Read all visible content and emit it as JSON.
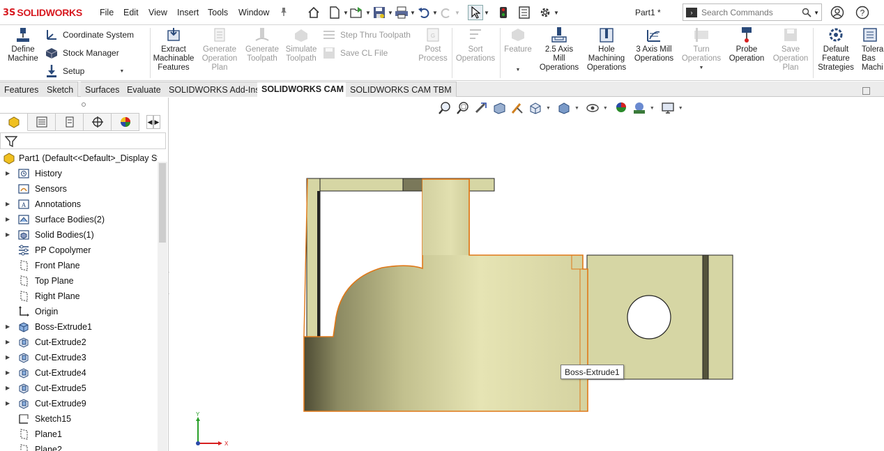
{
  "app": {
    "logo_ds": "3S",
    "logo_brand": "SOLIDWORKS",
    "menus": [
      "File",
      "Edit",
      "View",
      "Insert",
      "Tools",
      "Window"
    ],
    "document_title": "Part1 *",
    "search_placeholder": "Search Commands"
  },
  "command_manager": {
    "define_machine": "Define\nMachine",
    "coordinate_system": "Coordinate System",
    "stock_manager": "Stock Manager",
    "setup": "Setup",
    "extract_features": "Extract\nMachinable\nFeatures",
    "generate_operation_plan": "Generate\nOperation\nPlan",
    "generate_toolpath": "Generate\nToolpath",
    "simulate_toolpath": "Simulate\nToolpath",
    "step_thru_toolpath": "Step Thru Toolpath",
    "save_cl_file": "Save CL File",
    "post_process": "Post\nProcess",
    "sort_operations": "Sort\nOperations",
    "feature": "Feature",
    "axis25_mill": "2.5 Axis\nMill\nOperations",
    "hole_machining": "Hole\nMachining\nOperations",
    "axis3_mill": "3 Axis Mill\nOperations",
    "turn_operations": "Turn\nOperations",
    "probe_operation": "Probe\nOperation",
    "save_operation_plan": "Save\nOperation\nPlan",
    "default_feature_strategies": "Default\nFeature\nStrategies",
    "tolerance_based": "Tolera\nBas\nMachi"
  },
  "tabs": [
    {
      "label": "Features",
      "active": false
    },
    {
      "label": "Sketch",
      "active": false
    },
    {
      "label": "Surfaces",
      "active": false
    },
    {
      "label": "Evaluate",
      "active": false
    },
    {
      "label": "SOLIDWORKS Add-Ins",
      "active": false
    },
    {
      "label": "SOLIDWORKS CAM",
      "active": true
    },
    {
      "label": "SOLIDWORKS CAM TBM",
      "active": false
    }
  ],
  "feature_tree": {
    "root": "Part1  (Default<<Default>_Display Sta",
    "items": [
      {
        "label": "History",
        "icon": "history-folder-icon",
        "expandable": true
      },
      {
        "label": "Sensors",
        "icon": "sensors-folder-icon",
        "expandable": false
      },
      {
        "label": "Annotations",
        "icon": "annotations-folder-icon",
        "expandable": true
      },
      {
        "label": "Surface Bodies(2)",
        "icon": "surface-bodies-icon",
        "expandable": true
      },
      {
        "label": "Solid Bodies(1)",
        "icon": "solid-bodies-icon",
        "expandable": true
      },
      {
        "label": "PP Copolymer",
        "icon": "material-icon",
        "expandable": false
      },
      {
        "label": "Front Plane",
        "icon": "plane-icon",
        "expandable": false
      },
      {
        "label": "Top Plane",
        "icon": "plane-icon",
        "expandable": false
      },
      {
        "label": "Right Plane",
        "icon": "plane-icon",
        "expandable": false
      },
      {
        "label": "Origin",
        "icon": "origin-icon",
        "expandable": false
      },
      {
        "label": "Boss-Extrude1",
        "icon": "extrude-icon",
        "expandable": true
      },
      {
        "label": "Cut-Extrude2",
        "icon": "cut-extrude-icon",
        "expandable": true
      },
      {
        "label": "Cut-Extrude3",
        "icon": "cut-extrude-icon",
        "expandable": true
      },
      {
        "label": "Cut-Extrude4",
        "icon": "cut-extrude-icon",
        "expandable": true
      },
      {
        "label": "Cut-Extrude5",
        "icon": "cut-extrude-icon",
        "expandable": true
      },
      {
        "label": "Cut-Extrude9",
        "icon": "cut-extrude-icon",
        "expandable": true
      },
      {
        "label": "Sketch15",
        "icon": "sketch-icon",
        "expandable": false
      },
      {
        "label": "Plane1",
        "icon": "plane-icon",
        "expandable": false
      },
      {
        "label": "Plane2",
        "icon": "plane-icon",
        "expandable": false
      }
    ]
  },
  "graphics": {
    "tooltip": "Boss-Extrude1",
    "triad_y": "Y",
    "triad_x": "X"
  },
  "colors": {
    "accent_red": "#d71920",
    "model_face": "#d6d6a4",
    "selection_edge": "#e07818",
    "active_tab": "#ffffff"
  }
}
